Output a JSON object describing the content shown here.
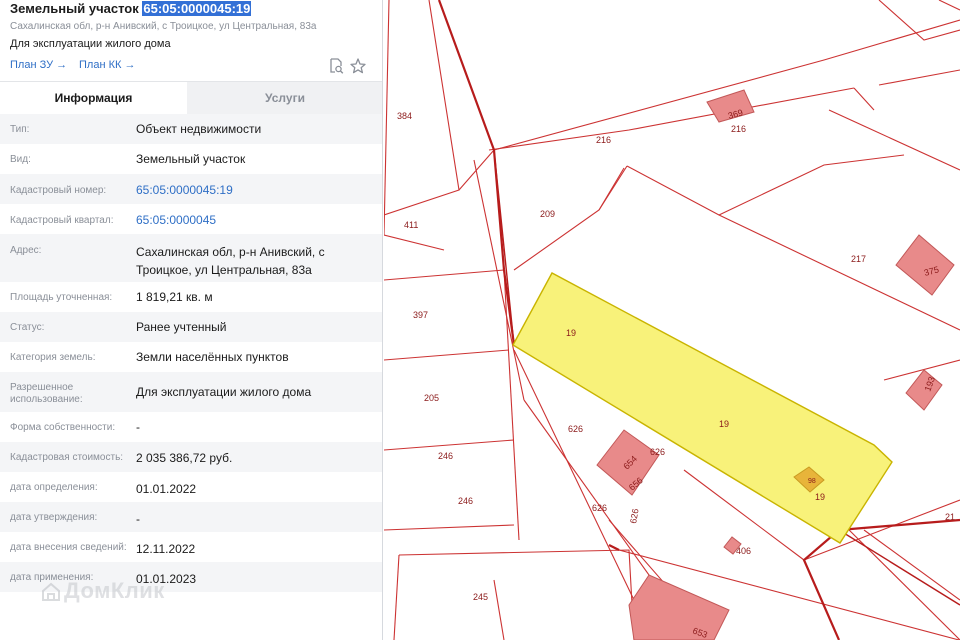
{
  "header": {
    "title_prefix": "Земельный участок",
    "title_number": "65:05:0000045:19",
    "address": "Сахалинская обл, р-н Анивский, с Троицкое, ул Центральная, 83а",
    "usage": "Для эксплуатации жилого дома",
    "plan_zu": "План ЗУ →",
    "plan_kk": "План КК →",
    "icons": [
      "document-search-icon",
      "star-icon"
    ]
  },
  "tabs": {
    "info": "Информация",
    "services": "Услуги",
    "active": "info"
  },
  "properties": [
    {
      "label": "Тип:",
      "value": "Объект недвижимости"
    },
    {
      "label": "Вид:",
      "value": "Земельный участок"
    },
    {
      "label": "Кадастровый номер:",
      "value": "65:05:0000045:19",
      "link": true
    },
    {
      "label": "Кадастровый квартал:",
      "value": "65:05:0000045",
      "link": true
    },
    {
      "label": "Адрес:",
      "value": "Сахалинская обл, р-н Анивский, с Троицкое, ул Центральная, 83а"
    },
    {
      "label": "Площадь уточненная:",
      "value": "1 819,21 кв. м"
    },
    {
      "label": "Статус:",
      "value": "Ранее учтенный"
    },
    {
      "label": "Категория земель:",
      "value": "Земли населённых пунктов"
    },
    {
      "label": "Разрешенное использование:",
      "value": "Для эксплуатации жилого дома"
    },
    {
      "label": "Форма собственности:",
      "value": "-"
    },
    {
      "label": "Кадастровая стоимость:",
      "value": "2 035 386,72 руб."
    },
    {
      "label": "дата определения:",
      "value": "01.01.2022"
    },
    {
      "label": "дата утверждения:",
      "value": "-"
    },
    {
      "label": "дата внесения сведений:",
      "value": "12.11.2022"
    },
    {
      "label": "дата применения:",
      "value": "01.01.2023"
    }
  ],
  "watermark": "ДомКлик",
  "map": {
    "parcel_labels": [
      "384",
      "216",
      "369",
      "216",
      "411",
      "209",
      "217",
      "375",
      "397",
      "19",
      "205",
      "626",
      "19",
      "193",
      "246",
      "626",
      "654",
      "656",
      "98",
      "19",
      "246",
      "626",
      "626",
      "406",
      "21",
      "245",
      "653"
    ],
    "colors": {
      "boundary": "#c62828",
      "boundary_thick": "#b71c1c",
      "building_fill": "#e88a8a",
      "selected_fill": "#f8f27a",
      "selected_stroke": "#c9b400",
      "link": "#2f6fc6",
      "selection": "#3370d6"
    }
  }
}
